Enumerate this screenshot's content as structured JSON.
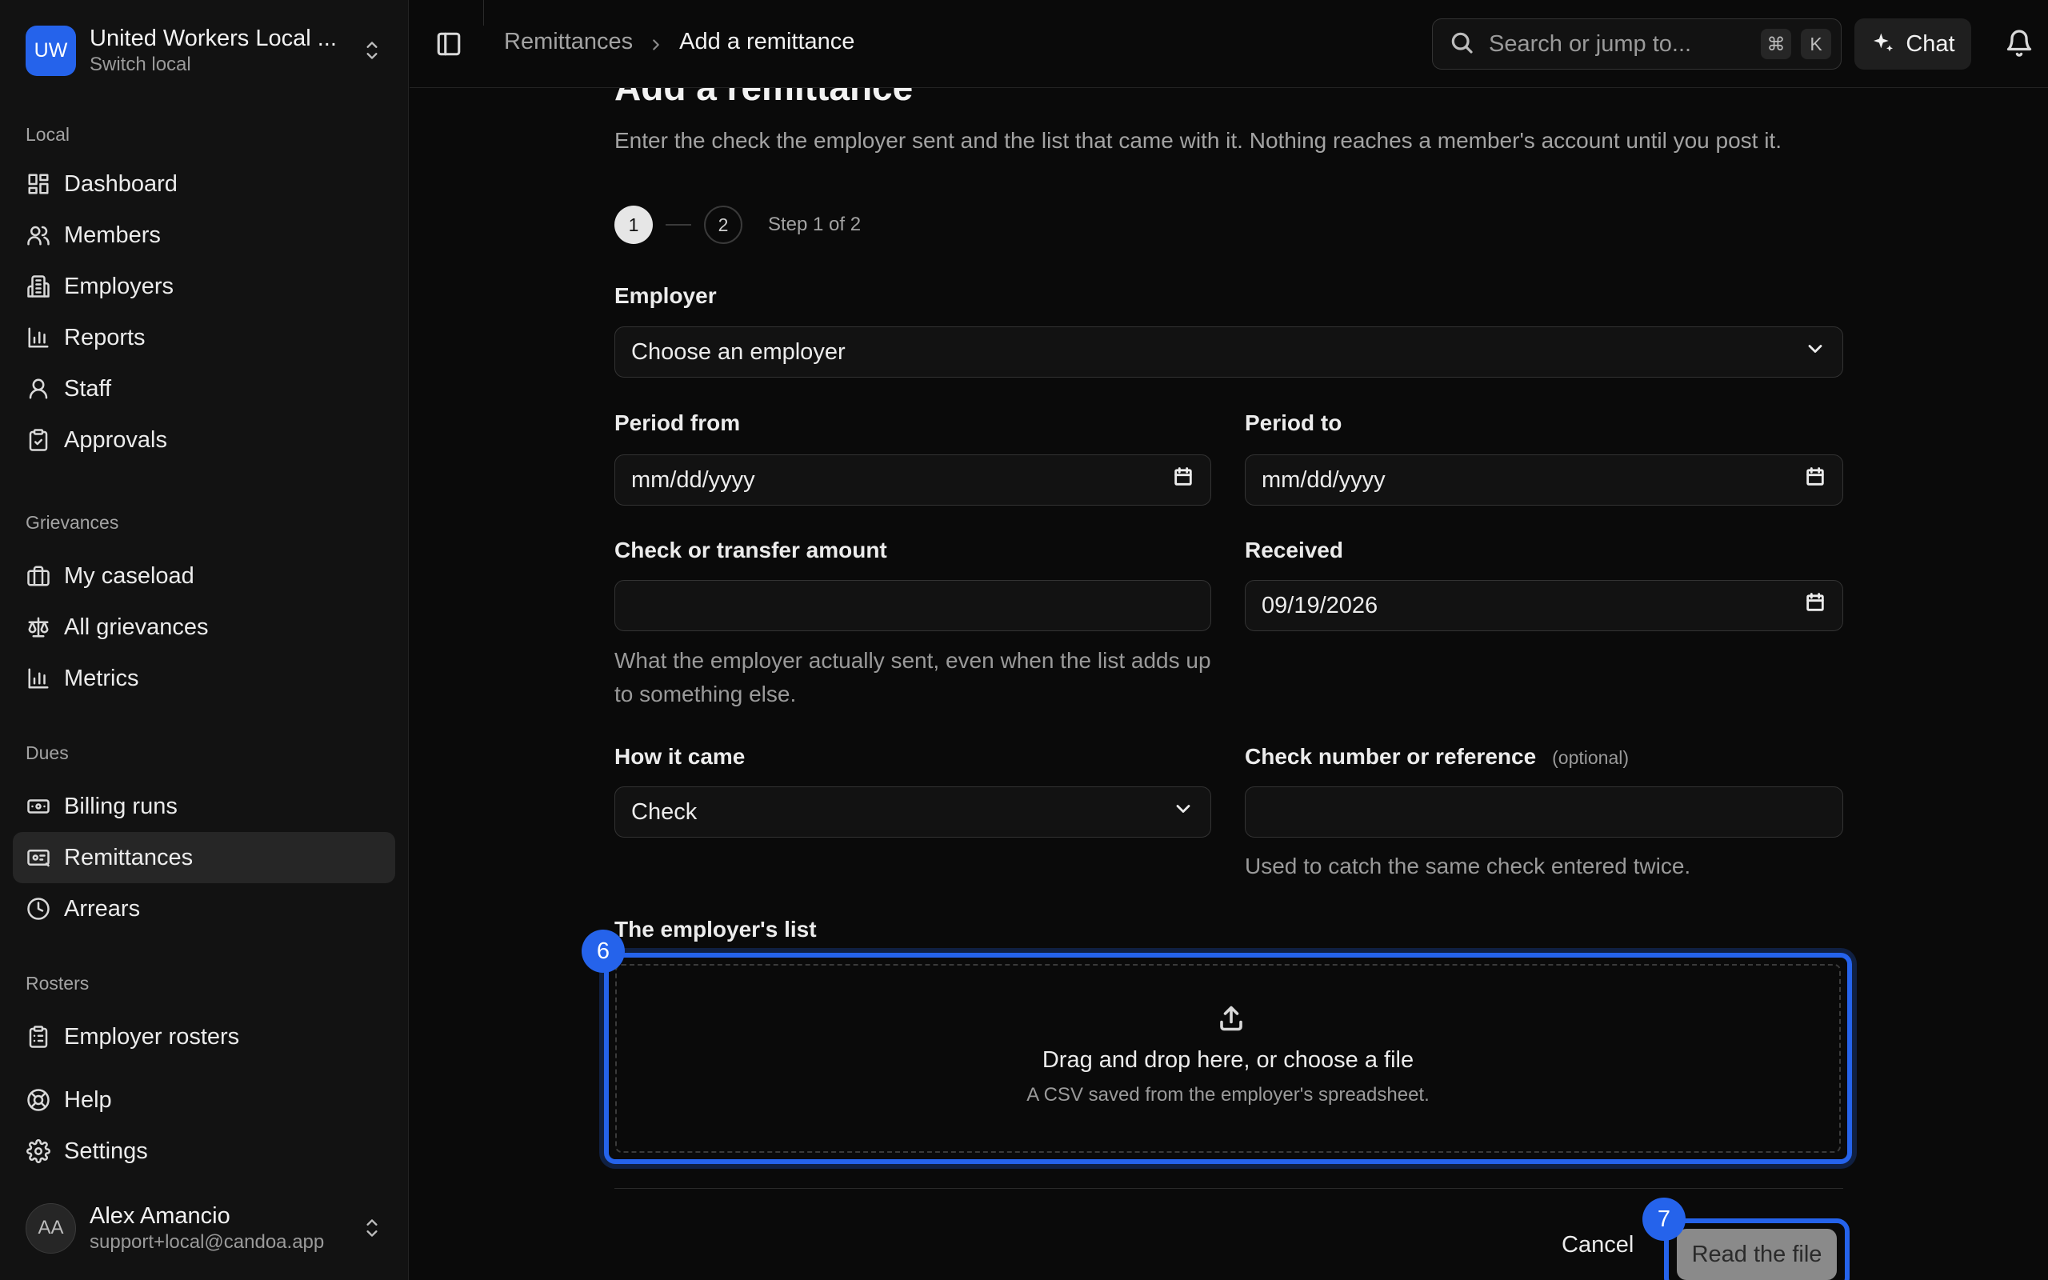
{
  "org": {
    "initials": "UW",
    "name": "United Workers Local ...",
    "subtitle": "Switch local"
  },
  "sidebar": {
    "sections": {
      "local": "Local",
      "grievances": "Grievances",
      "dues": "Dues",
      "rosters": "Rosters"
    },
    "items": [
      {
        "label": "Dashboard",
        "icon": "dashboard-icon"
      },
      {
        "label": "Members",
        "icon": "users-icon"
      },
      {
        "label": "Employers",
        "icon": "building-icon"
      },
      {
        "label": "Reports",
        "icon": "bar-chart-icon"
      },
      {
        "label": "Staff",
        "icon": "user-icon"
      },
      {
        "label": "Approvals",
        "icon": "clipboard-check-icon"
      },
      {
        "label": "My caseload",
        "icon": "briefcase-icon"
      },
      {
        "label": "All grievances",
        "icon": "scale-icon"
      },
      {
        "label": "Metrics",
        "icon": "bar-chart-icon"
      },
      {
        "label": "Billing runs",
        "icon": "banknote-icon"
      },
      {
        "label": "Remittances",
        "icon": "receipt-icon",
        "active": true
      },
      {
        "label": "Arrears",
        "icon": "clock-icon"
      },
      {
        "label": "Employer rosters",
        "icon": "clipboard-list-icon"
      },
      {
        "label": "Help",
        "icon": "lifebuoy-icon"
      },
      {
        "label": "Settings",
        "icon": "gear-icon"
      }
    ]
  },
  "user": {
    "initials": "AA",
    "name": "Alex Amancio",
    "email": "support+local@candoa.app"
  },
  "topbar": {
    "breadcrumb_parent": "Remittances",
    "breadcrumb_current": "Add a remittance",
    "search_placeholder": "Search or jump to...",
    "shortcut_mod": "⌘",
    "shortcut_key": "K",
    "chat_label": "Chat"
  },
  "form": {
    "title": "Add a remittance",
    "description": "Enter the check the employer sent and the list that came with it. Nothing reaches a member's account until you post it.",
    "steps": {
      "step1": "1",
      "step2": "2",
      "status": "Step 1 of 2"
    },
    "employer": {
      "label": "Employer",
      "value": "Choose an employer"
    },
    "period_from": {
      "label": "Period from",
      "value": "mm/dd/yyyy"
    },
    "period_to": {
      "label": "Period to",
      "value": "mm/dd/yyyy"
    },
    "amount": {
      "label": "Check or transfer amount",
      "value": "",
      "hint": "What the employer actually sent, even when the list adds up to something else."
    },
    "received": {
      "label": "Received",
      "value": "09/19/2026"
    },
    "how_it_came": {
      "label": "How it came",
      "value": "Check"
    },
    "reference": {
      "label": "Check number or reference",
      "optional": "(optional)",
      "value": "",
      "hint": "Used to catch the same check entered twice."
    },
    "list": {
      "label": "The employer's list",
      "drop_title": "Drag and drop here, or choose a file",
      "drop_sub": "A CSV saved from the employer's spreadsheet."
    },
    "cancel_label": "Cancel",
    "submit_label": "Read the file"
  },
  "annotations": {
    "dropzone_badge": "6",
    "submit_badge": "7"
  },
  "colors": {
    "accent": "#2563eb",
    "background": "#0a0a0a",
    "sidebar": "#121212"
  }
}
